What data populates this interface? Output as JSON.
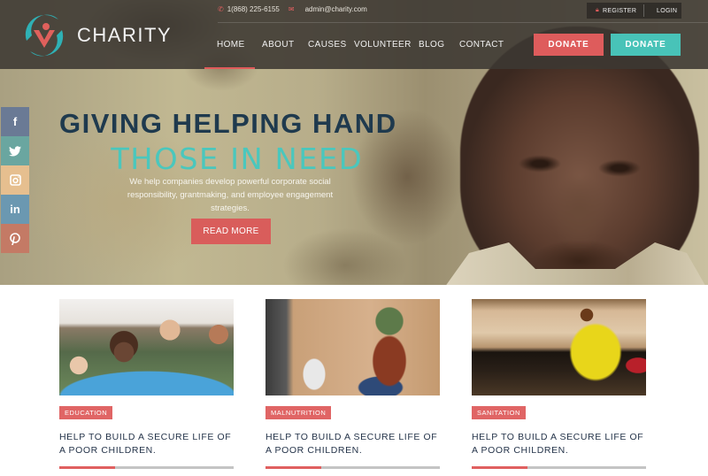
{
  "brand": {
    "name": "CHARITY",
    "logo_icon": "helping-hands-logo"
  },
  "topbar": {
    "phone_icon": "phone-icon",
    "phone": "1(868) 225-6155",
    "email_icon": "envelope-icon",
    "email": "admin@charity.com"
  },
  "auth": {
    "register_icon": "lock-icon",
    "register": "REGISTER",
    "login": "LOGIN"
  },
  "nav": {
    "items": [
      {
        "label": "HOME",
        "active": true
      },
      {
        "label": "ABOUT"
      },
      {
        "label": "CAUSES"
      },
      {
        "label": "VOLUNTEER"
      },
      {
        "label": "BLOG"
      },
      {
        "label": "CONTACT"
      }
    ],
    "donate_primary": "DONATE",
    "donate_secondary": "DONATE"
  },
  "colors": {
    "accent_red": "#de5c5c",
    "accent_teal": "#48c3b8",
    "heading_dark": "#1f3a4e"
  },
  "social": [
    {
      "name": "facebook",
      "glyph": "f"
    },
    {
      "name": "twitter",
      "glyph": "🐦"
    },
    {
      "name": "instagram",
      "glyph": "◙"
    },
    {
      "name": "linkedin",
      "glyph": "in"
    },
    {
      "name": "pinterest",
      "glyph": "℗"
    }
  ],
  "hero": {
    "title_line1": "GIVING HELPING HAND",
    "title_line2": "THOSE IN NEED",
    "description": "We help companies develop powerful corporate social responsibility, grantmaking, and employee engagement strategies.",
    "cta": "READ MORE"
  },
  "causes": [
    {
      "tag": "EDUCATION",
      "title": "HELP TO BUILD A SECURE LIFE OF A POOR CHILDREN.",
      "progress": 0.32,
      "image": "volunteers-group-photo"
    },
    {
      "tag": "MALNUTRITION",
      "title": "HELP TO BUILD A SECURE LIFE OF A POOR CHILDREN.",
      "progress": 0.32,
      "image": "woman-receiving-aid-photo"
    },
    {
      "tag": "SANITATION",
      "title": "HELP TO BUILD A SECURE LIFE OF A POOR CHILDREN.",
      "progress": 0.32,
      "image": "monk-on-steps-photo"
    }
  ]
}
